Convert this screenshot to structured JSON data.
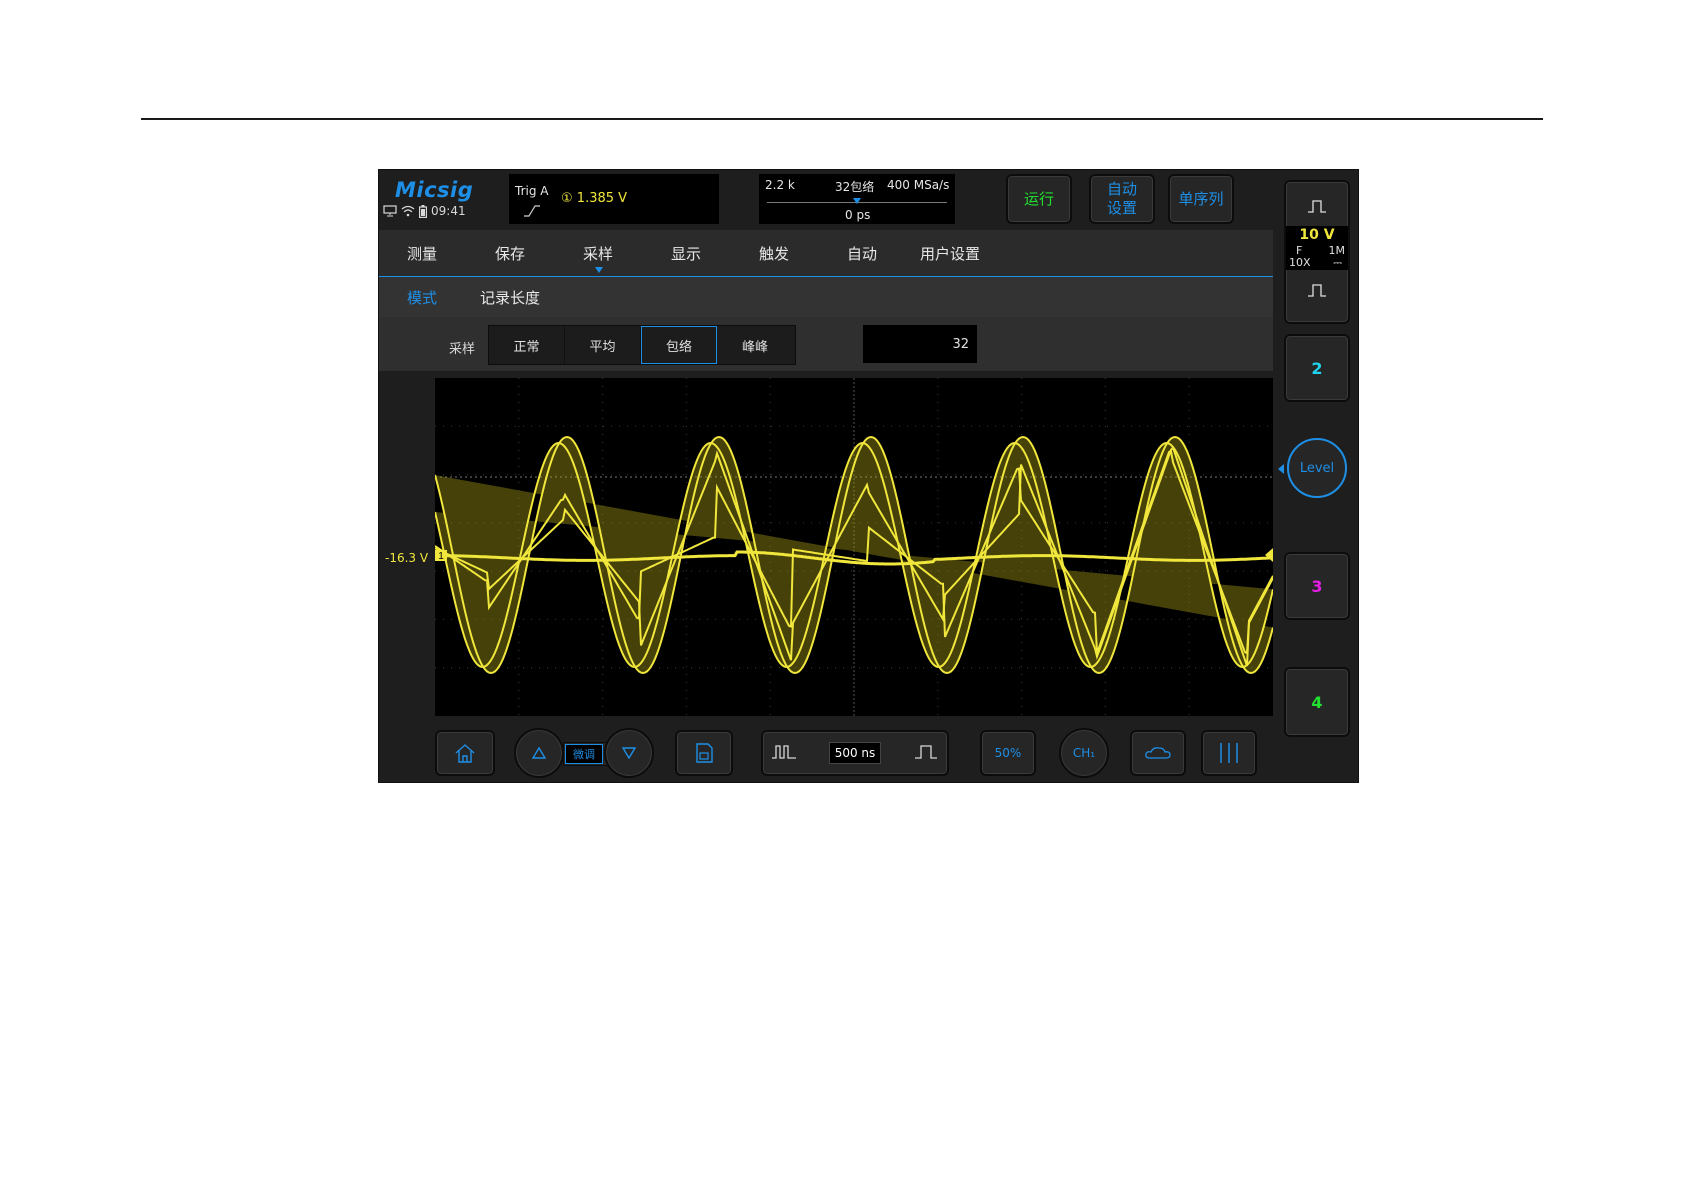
{
  "app": {
    "logo": "Micsig",
    "clock": "09:41"
  },
  "trigger": {
    "label": "Trig  A",
    "channel_symbol": "①",
    "value": "1.385  V"
  },
  "timebase": {
    "memory": "2.2 k",
    "mode": "32包络",
    "sample_rate": "400 MSa/s",
    "position": "0 ps",
    "scale": "500 ns"
  },
  "top_buttons": {
    "run": "运行",
    "auto_line1": "自动",
    "auto_line2": "设置",
    "single": "单序列"
  },
  "menu": {
    "items": [
      "测量",
      "保存",
      "采样",
      "显示",
      "触发",
      "自动",
      "用户设置"
    ],
    "active_index": 2
  },
  "submenu": {
    "items": [
      "模式",
      "记录长度"
    ],
    "active_index": 0
  },
  "sampling": {
    "label": "采样",
    "options": [
      "正常",
      "平均",
      "包络",
      "峰峰"
    ],
    "selected_index": 2,
    "count": "32"
  },
  "waveform": {
    "channel_marker": "1",
    "offset_label": "-16.3 V"
  },
  "channel1": {
    "scale": "10 V",
    "coupling": "F",
    "probe": "10X",
    "impedance": "1M",
    "dc_symbol": "⎓"
  },
  "side_channels": {
    "ch2": "2",
    "level": "Level",
    "ch3": "3",
    "ch4": "4"
  },
  "bottom_bar": {
    "fine_label": "微调",
    "fifty_percent": "50%",
    "ch_label": "CH₁"
  },
  "colors": {
    "accent": "#1e8fe6",
    "ch1": "#f0e63c",
    "ch2": "#22d3ee",
    "ch3": "#e21ee2",
    "ch4": "#22e030",
    "run": "#22e030"
  }
}
